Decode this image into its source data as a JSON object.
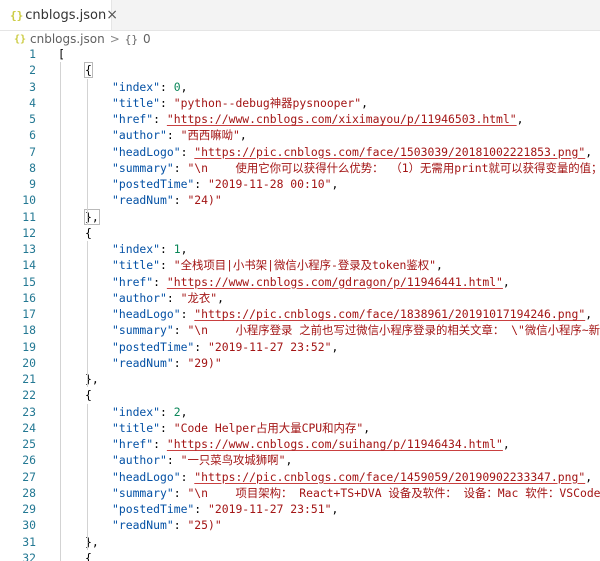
{
  "tab": {
    "icon": "json-braces-icon",
    "title": "cnblogs.json",
    "close": "×"
  },
  "breadcrumb": {
    "file": "cnblogs.json",
    "separator": ">",
    "symbol": "{}",
    "index": "0"
  },
  "lines": [
    {
      "n": "1",
      "ind": 0,
      "t": "["
    },
    {
      "n": "2",
      "ind": 1,
      "t": "{"
    },
    {
      "n": "3",
      "ind": 2,
      "k": "index",
      "v": "0",
      "vt": "n",
      "c": ","
    },
    {
      "n": "4",
      "ind": 2,
      "k": "title",
      "v": "\"python--debug神器pysnooper\"",
      "vt": "s",
      "c": ","
    },
    {
      "n": "5",
      "ind": 2,
      "k": "href",
      "v": "\"https://www.cnblogs.com/xiximayou/p/11946503.html\"",
      "vt": "s",
      "url": true,
      "c": ","
    },
    {
      "n": "6",
      "ind": 2,
      "k": "author",
      "v": "\"西西嘛呦\"",
      "vt": "s",
      "c": ","
    },
    {
      "n": "7",
      "ind": 2,
      "k": "headLogo",
      "v": "\"https://pic.cnblogs.com/face/1503039/20181002221853.png\"",
      "vt": "s",
      "url": true,
      "c": ","
    },
    {
      "n": "8",
      "ind": 2,
      "k": "summary",
      "v": "\"\\n    使用它你可以获得什么优势： （1）无需用print就可以获得变量的值；",
      "vt": "s",
      "c": ""
    },
    {
      "n": "9",
      "ind": 2,
      "k": "postedTime",
      "v": "\"2019-11-28 00:10\"",
      "vt": "s",
      "c": ","
    },
    {
      "n": "10",
      "ind": 2,
      "k": "readNum",
      "v": "\"24)\"",
      "vt": "s",
      "c": ""
    },
    {
      "n": "11",
      "ind": 1,
      "t": "},"
    },
    {
      "n": "12",
      "ind": 1,
      "t": "{"
    },
    {
      "n": "13",
      "ind": 2,
      "k": "index",
      "v": "1",
      "vt": "n",
      "c": ","
    },
    {
      "n": "14",
      "ind": 2,
      "k": "title",
      "v": "\"全栈项目|小书架|微信小程序-登录及token鉴权\"",
      "vt": "s",
      "c": ","
    },
    {
      "n": "15",
      "ind": 2,
      "k": "href",
      "v": "\"https://www.cnblogs.com/gdragon/p/11946441.html\"",
      "vt": "s",
      "url": true,
      "c": ","
    },
    {
      "n": "16",
      "ind": 2,
      "k": "author",
      "v": "\"龙衣\"",
      "vt": "s",
      "c": ","
    },
    {
      "n": "17",
      "ind": 2,
      "k": "headLogo",
      "v": "\"https://pic.cnblogs.com/face/1838961/20191017194246.png\"",
      "vt": "s",
      "url": true,
      "c": ","
    },
    {
      "n": "18",
      "ind": 2,
      "k": "summary",
      "v": "\"\\n    小程序登录 之前也写过微信小程序登录的相关文章： \\\"微信小程序~新",
      "vt": "s",
      "c": ""
    },
    {
      "n": "19",
      "ind": 2,
      "k": "postedTime",
      "v": "\"2019-11-27 23:52\"",
      "vt": "s",
      "c": ","
    },
    {
      "n": "20",
      "ind": 2,
      "k": "readNum",
      "v": "\"29)\"",
      "vt": "s",
      "c": ""
    },
    {
      "n": "21",
      "ind": 1,
      "t": "},"
    },
    {
      "n": "22",
      "ind": 1,
      "t": "{"
    },
    {
      "n": "23",
      "ind": 2,
      "k": "index",
      "v": "2",
      "vt": "n",
      "c": ","
    },
    {
      "n": "24",
      "ind": 2,
      "k": "title",
      "v": "\"Code Helper占用大量CPU和内存\"",
      "vt": "s",
      "c": ","
    },
    {
      "n": "25",
      "ind": 2,
      "k": "href",
      "v": "\"https://www.cnblogs.com/suihang/p/11946434.html\"",
      "vt": "s",
      "url": true,
      "c": ","
    },
    {
      "n": "26",
      "ind": 2,
      "k": "author",
      "v": "\"一只菜鸟攻城狮啊\"",
      "vt": "s",
      "c": ","
    },
    {
      "n": "27",
      "ind": 2,
      "k": "headLogo",
      "v": "\"https://pic.cnblogs.com/face/1459059/20190902233347.png\"",
      "vt": "s",
      "url": true,
      "c": ","
    },
    {
      "n": "28",
      "ind": 2,
      "k": "summary",
      "v": "\"\\n    项目架构： React+TS+DVA 设备及软件： 设备：Mac 软件：VSCode 功",
      "vt": "s",
      "c": ""
    },
    {
      "n": "29",
      "ind": 2,
      "k": "postedTime",
      "v": "\"2019-11-27 23:51\"",
      "vt": "s",
      "c": ","
    },
    {
      "n": "30",
      "ind": 2,
      "k": "readNum",
      "v": "\"25)\"",
      "vt": "s",
      "c": ""
    },
    {
      "n": "31",
      "ind": 1,
      "t": "},"
    },
    {
      "n": "32",
      "ind": 1,
      "t": "{"
    }
  ],
  "colors": {
    "line_number": "#237893",
    "key": "#0451a5",
    "string": "#a31515",
    "number": "#098658"
  }
}
